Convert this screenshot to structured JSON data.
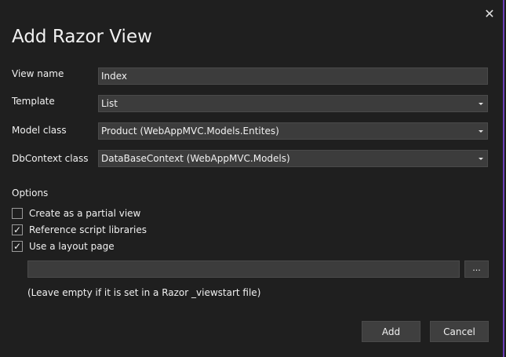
{
  "dialog": {
    "title": "Add Razor View",
    "close_glyph": "✕",
    "accent_color": "#6b3fb8"
  },
  "fields": {
    "view_name": {
      "label": "View name",
      "value": "Index"
    },
    "template": {
      "label": "Template",
      "value": "List"
    },
    "model_class": {
      "label": "Model class",
      "value": "Product (WebAppMVC.Models.Entites)"
    },
    "dbcontext_class": {
      "label": "DbContext class",
      "value": "DataBaseContext (WebAppMVC.Models)"
    }
  },
  "options": {
    "heading": "Options",
    "partial_view": {
      "label": "Create as a partial view",
      "checked": false
    },
    "script_libraries": {
      "label": "Reference script libraries",
      "checked": true
    },
    "layout_page": {
      "label": "Use a layout page",
      "checked": true
    },
    "layout_path": {
      "value": ""
    },
    "browse_label": "...",
    "hint": "(Leave empty if it is set in a Razor _viewstart file)"
  },
  "buttons": {
    "add": "Add",
    "cancel": "Cancel"
  }
}
